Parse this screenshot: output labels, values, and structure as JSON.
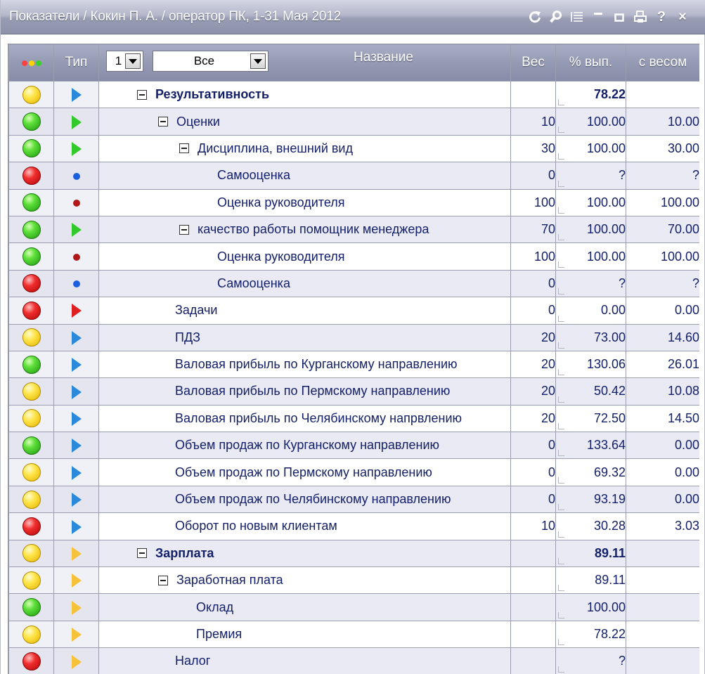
{
  "window": {
    "title": "Показатели / Кокин П. А. / оператор ПК, 1-31 Мая 2012",
    "icons": [
      "refresh-icon",
      "search-icon",
      "list-icon",
      "minimize-icon",
      "maximize-icon",
      "print-icon",
      "help-icon",
      "close-icon"
    ],
    "icon_glyphs": {
      "help": "?",
      "close": "×"
    }
  },
  "header": {
    "type": "Тип",
    "level_value": "1",
    "filter_value": "Все",
    "name": "Название",
    "weight": "Вес",
    "percent": "% вып.",
    "weighted": "с весом",
    "status_dot_colors": [
      "#ff4040",
      "#ffd400",
      "#39d12a"
    ]
  },
  "colors": {
    "header_bg": "#959ab4",
    "row_alt_bg": "#e9eaf4",
    "text": "#14206a"
  },
  "rows": [
    {
      "status": "yellow",
      "type": "tri-blue",
      "indent": 0,
      "expander": true,
      "name": "Результативность",
      "bold": true,
      "weight": "",
      "pct": "78.22",
      "pct_bold": true,
      "weighted": ""
    },
    {
      "status": "green",
      "type": "tri-green",
      "indent": 1,
      "expander": true,
      "name": "Оценки",
      "bold": false,
      "weight": "10",
      "pct": "100.00",
      "weighted": "10.00"
    },
    {
      "status": "green",
      "type": "tri-green",
      "indent": 2,
      "expander": true,
      "name": "Дисциплина, внешний вид",
      "bold": false,
      "weight": "30",
      "pct": "100.00",
      "weighted": "30.00"
    },
    {
      "status": "red",
      "type": "dot-blue",
      "indent": 3,
      "expander": false,
      "name": "Самооценка",
      "bold": false,
      "weight": "0",
      "pct": "?",
      "weighted": "?"
    },
    {
      "status": "green",
      "type": "dot-red",
      "indent": 3,
      "expander": false,
      "name": "Оценка руководителя",
      "bold": false,
      "weight": "100",
      "pct": "100.00",
      "weighted": "100.00"
    },
    {
      "status": "green",
      "type": "tri-green",
      "indent": 2,
      "expander": true,
      "name": "качество работы помощник менеджера",
      "bold": false,
      "weight": "70",
      "pct": "100.00",
      "weighted": "70.00"
    },
    {
      "status": "green",
      "type": "dot-red",
      "indent": 3,
      "expander": false,
      "name": "Оценка руководителя",
      "bold": false,
      "weight": "100",
      "pct": "100.00",
      "weighted": "100.00"
    },
    {
      "status": "red",
      "type": "dot-blue",
      "indent": 3,
      "expander": false,
      "name": "Самооценка",
      "bold": false,
      "weight": "0",
      "pct": "?",
      "weighted": "?"
    },
    {
      "status": "red",
      "type": "tri-red",
      "indent": 1,
      "expander": false,
      "name": "Задачи",
      "bold": false,
      "weight": "0",
      "pct": "0.00",
      "weighted": "0.00"
    },
    {
      "status": "yellow",
      "type": "tri-blue",
      "indent": 1,
      "expander": false,
      "name": "ПДЗ",
      "bold": false,
      "weight": "20",
      "pct": "73.00",
      "weighted": "14.60"
    },
    {
      "status": "green",
      "type": "tri-blue",
      "indent": 1,
      "expander": false,
      "name": "Валовая прибыль по Курганскому направлению",
      "bold": false,
      "weight": "20",
      "pct": "130.06",
      "weighted": "26.01"
    },
    {
      "status": "yellow",
      "type": "tri-blue",
      "indent": 1,
      "expander": false,
      "name": "Валовая прибыль по Пермскому направлению",
      "bold": false,
      "weight": "20",
      "pct": "50.42",
      "weighted": "10.08"
    },
    {
      "status": "yellow",
      "type": "tri-blue",
      "indent": 1,
      "expander": false,
      "name": "Валовая прибыль по Челябинскому напрвлению",
      "bold": false,
      "weight": "20",
      "pct": "72.50",
      "weighted": "14.50"
    },
    {
      "status": "green",
      "type": "tri-blue",
      "indent": 1,
      "expander": false,
      "name": "Объем продаж по Курганскому направлению",
      "bold": false,
      "weight": "0",
      "pct": "133.64",
      "weighted": "0.00"
    },
    {
      "status": "yellow",
      "type": "tri-blue",
      "indent": 1,
      "expander": false,
      "name": "Объем продаж по Пермскому направлению",
      "bold": false,
      "weight": "0",
      "pct": "69.32",
      "weighted": "0.00"
    },
    {
      "status": "yellow",
      "type": "tri-blue",
      "indent": 1,
      "expander": false,
      "name": "Объем продаж по Челябинскому направлению",
      "bold": false,
      "weight": "0",
      "pct": "93.19",
      "weighted": "0.00"
    },
    {
      "status": "red",
      "type": "tri-blue",
      "indent": 1,
      "expander": false,
      "name": "Оборот по новым клиентам",
      "bold": false,
      "weight": "10",
      "pct": "30.28",
      "weighted": "3.03"
    },
    {
      "status": "yellow",
      "type": "tri-orange",
      "indent": 0,
      "expander": true,
      "name": "Зарплата",
      "bold": true,
      "weight": "",
      "pct": "89.11",
      "pct_bold": true,
      "weighted": ""
    },
    {
      "status": "yellow",
      "type": "tri-orange",
      "indent": 1,
      "expander": true,
      "name": "Заработная плата",
      "bold": false,
      "weight": "",
      "pct": "89.11",
      "weighted": ""
    },
    {
      "status": "green",
      "type": "tri-orange",
      "indent": 2,
      "expander": false,
      "name": "Оклад",
      "bold": false,
      "weight": "",
      "pct": "100.00",
      "weighted": ""
    },
    {
      "status": "yellow",
      "type": "tri-orange",
      "indent": 2,
      "expander": false,
      "name": "Премия",
      "bold": false,
      "weight": "",
      "pct": "78.22",
      "weighted": ""
    },
    {
      "status": "red",
      "type": "tri-orange",
      "indent": 1,
      "expander": false,
      "name": "Налог",
      "bold": false,
      "weight": "",
      "pct": "?",
      "weighted": ""
    }
  ]
}
